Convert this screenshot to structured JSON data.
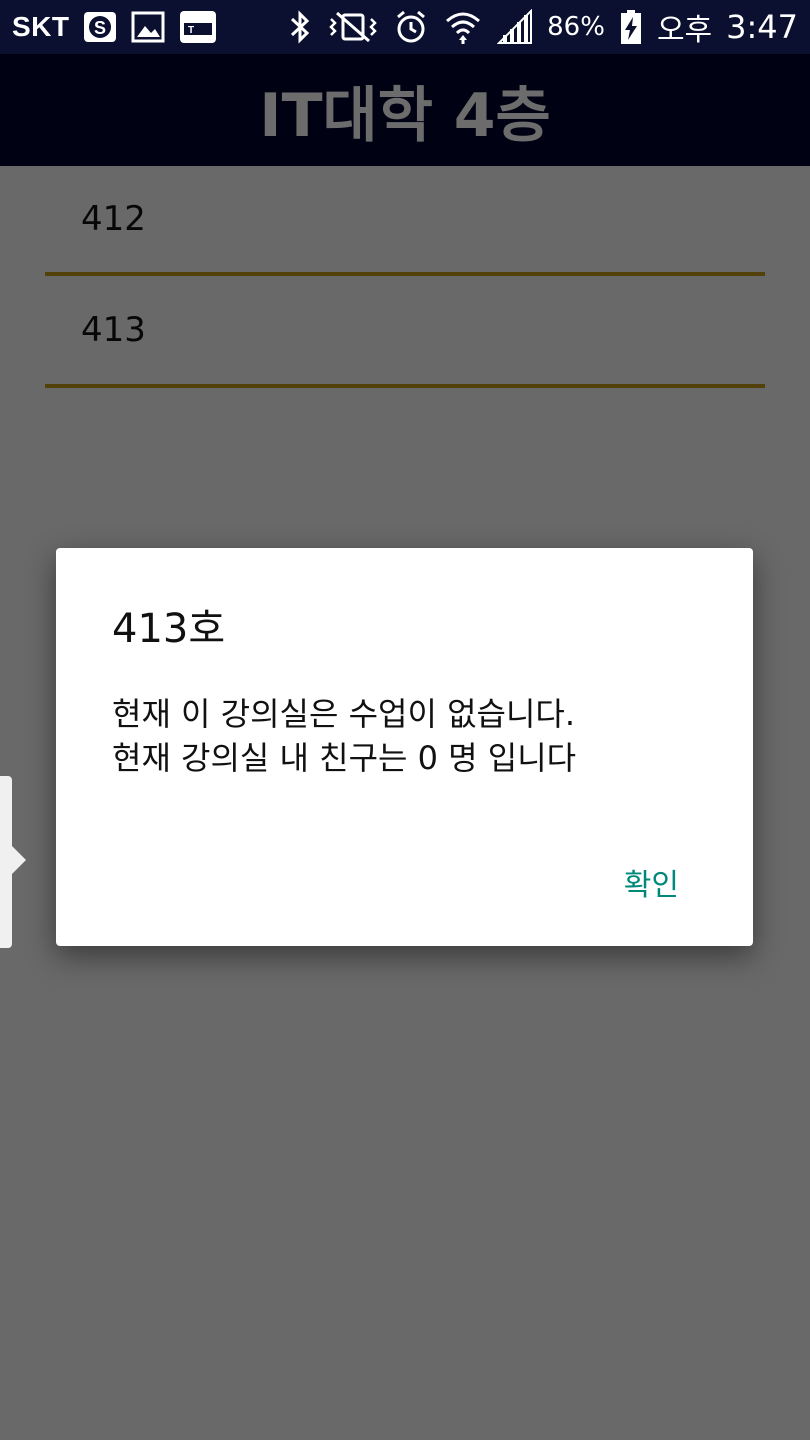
{
  "status_bar": {
    "carrier": "SKT",
    "battery": "86%",
    "ampm": "오후",
    "time": "3:47",
    "icons": [
      "s-app-icon",
      "gallery-icon",
      "tmoney-icon",
      "bluetooth-icon",
      "vibrate-icon",
      "alarm-icon",
      "wifi-icon",
      "signal-icon",
      "battery-charging-icon"
    ]
  },
  "app_bar": {
    "title": "IT대학 4층"
  },
  "rooms": [
    {
      "label": "412"
    },
    {
      "label": "413"
    }
  ],
  "dialog": {
    "title": "413호",
    "message_lines": [
      "현재 이 강의실은 수업이 없습니다.",
      "현재 강의실 내 친구는 0 명 입니다"
    ],
    "confirm_label": "확인"
  },
  "colors": {
    "status_bar_bg": "#0b1030",
    "app_bar_bg": "#000214",
    "divider": "#c39d17",
    "dialog_button": "#00897b"
  }
}
